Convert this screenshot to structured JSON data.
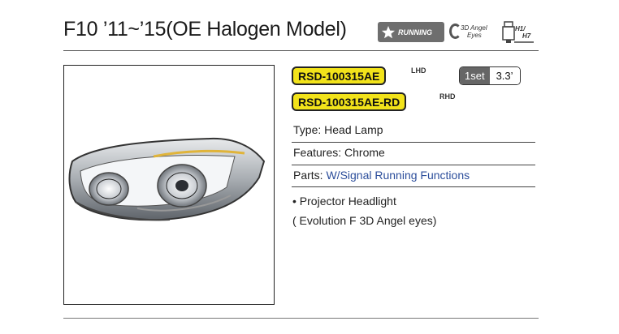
{
  "header": {
    "title": "F10 ’11~’15(OE Halogen Model)",
    "badge_running": "RUNNING",
    "badge_angel_line1": "3D Angel",
    "badge_angel_line2": "Eyes",
    "badge_bulb_line1": "H1/",
    "badge_bulb_line2": "H7"
  },
  "parts": [
    {
      "number": "RSD-100315AE",
      "side": "LHD"
    },
    {
      "number": "RSD-100315AE-RD",
      "side": "RHD"
    }
  ],
  "package": {
    "qty": "1set",
    "weight": "3.3’"
  },
  "specs": {
    "type_label": "Type:",
    "type_value": "Head Lamp",
    "features_label": "Features:",
    "features_value": "Chrome",
    "parts_label": "Parts:",
    "parts_value": "W/Signal Running Functions"
  },
  "notes": {
    "bullet": "• Projector Headlight",
    "sub": "( Evolution F 3D Angel eyes)"
  },
  "colors": {
    "part_highlight": "#f2e31a",
    "parts_link": "#2c4e9b",
    "badge_bg": "#6e6e6e"
  }
}
